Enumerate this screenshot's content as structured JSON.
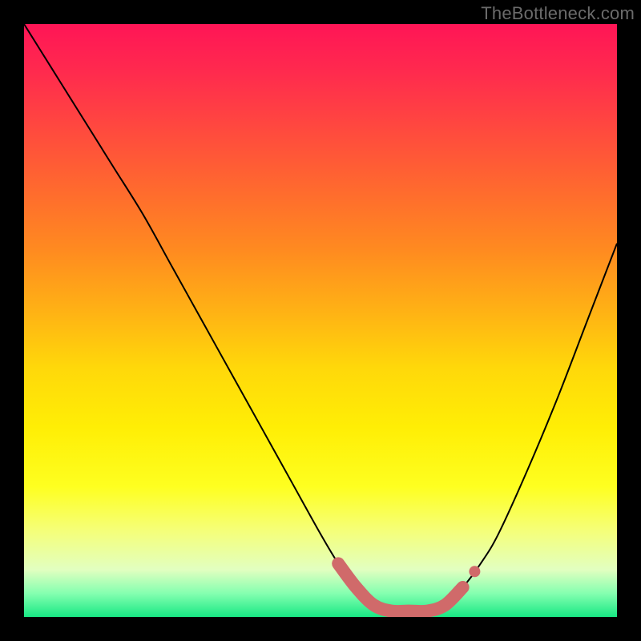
{
  "watermark": "TheBottleneck.com",
  "chart_data": {
    "type": "line",
    "title": "",
    "xlabel": "",
    "ylabel": "",
    "xlim": [
      0,
      100
    ],
    "ylim": [
      0,
      100
    ],
    "series": [
      {
        "name": "bottleneck-curve",
        "x": [
          0,
          5,
          10,
          15,
          20,
          25,
          30,
          35,
          40,
          45,
          50,
          53,
          56,
          59,
          62,
          65,
          68,
          71,
          74,
          77,
          80,
          85,
          90,
          95,
          100
        ],
        "y": [
          100,
          92,
          84,
          76,
          68,
          59,
          50,
          41,
          32,
          23,
          14,
          9,
          5,
          2,
          1,
          1,
          1,
          2,
          5,
          9,
          14,
          25,
          37,
          50,
          63
        ]
      },
      {
        "name": "optimal-highlight",
        "x": [
          53,
          56,
          59,
          62,
          65,
          68,
          71,
          74
        ],
        "y": [
          9,
          5,
          2,
          1,
          1,
          1,
          2,
          5
        ]
      }
    ],
    "annotations": [],
    "background_gradient": {
      "top": "#ff1556",
      "bottom": "#18e884"
    },
    "highlight_color": "#d06a6a",
    "curve_color": "#000000"
  }
}
